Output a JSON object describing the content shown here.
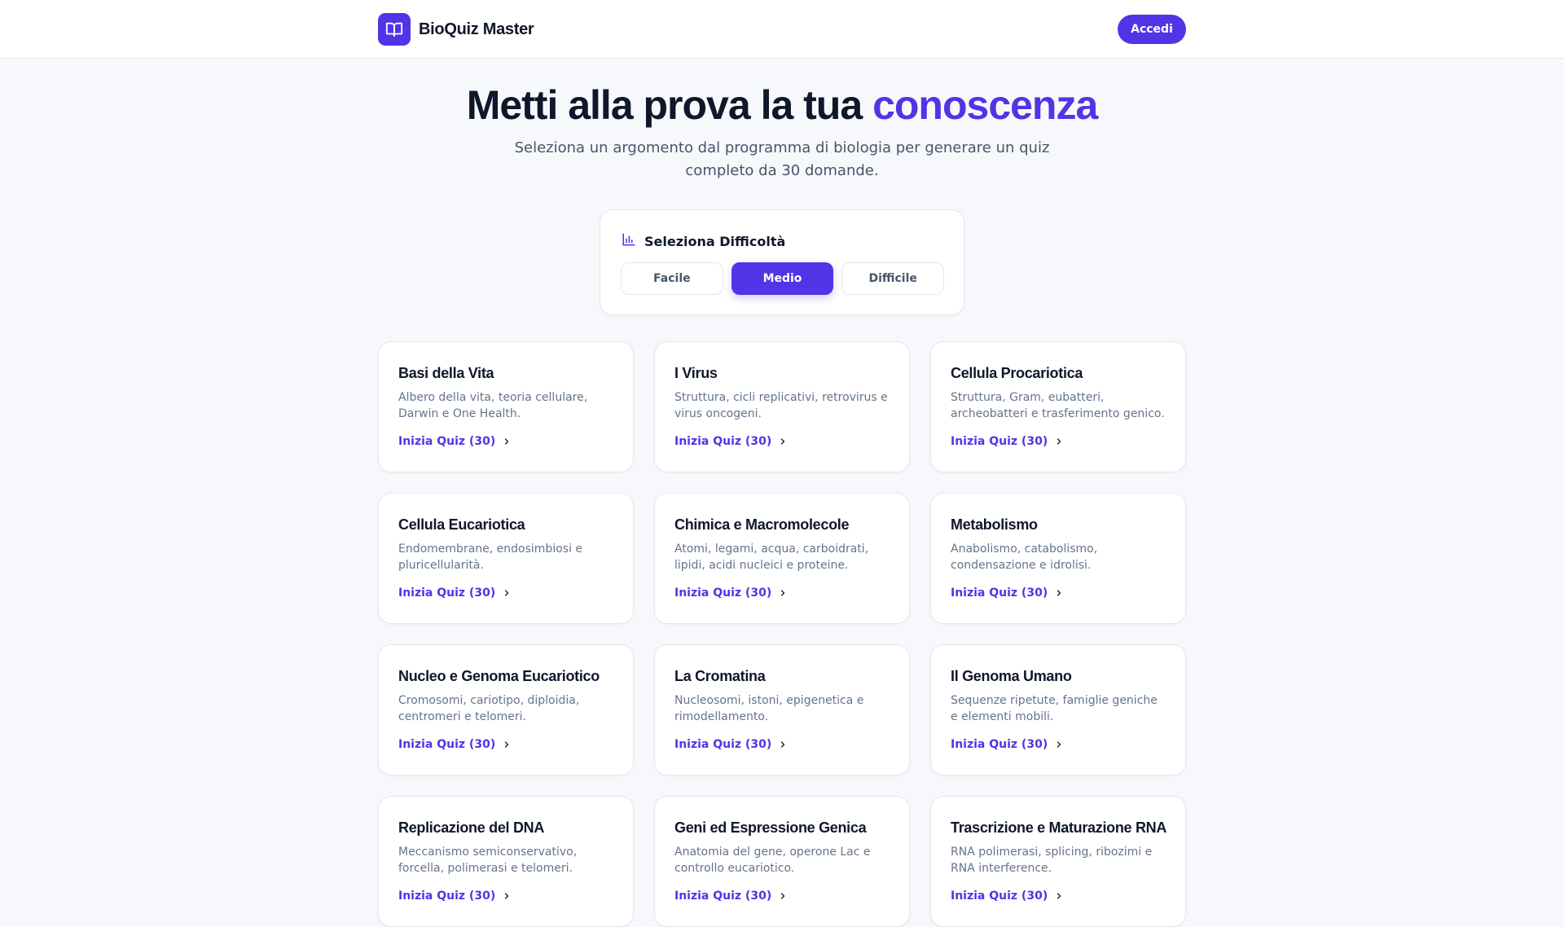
{
  "header": {
    "brand_name": "BioQuiz Master",
    "logo_icon": "book-open-icon",
    "login_label": "Accedi"
  },
  "hero": {
    "title_main": "Metti alla prova la tua",
    "title_accent": "conoscenza",
    "subtitle": "Seleziona un argomento dal programma di biologia per generare un quiz completo da 30 domande."
  },
  "difficulty": {
    "title": "Seleziona Difficoltà",
    "icon": "bar-chart-icon",
    "options": [
      "Facile",
      "Medio",
      "Difficile"
    ],
    "selected": "Medio"
  },
  "topics": [
    {
      "title": "Basi della Vita",
      "desc": "Albero della vita, teoria cellulare, Darwin e One Health.",
      "cta": "Inizia Quiz (30)"
    },
    {
      "title": "I Virus",
      "desc": "Struttura, cicli replicativi, retrovirus e virus oncogeni.",
      "cta": "Inizia Quiz (30)"
    },
    {
      "title": "Cellula Procariotica",
      "desc": "Struttura, Gram, eubatteri, archeobatteri e trasferimento genico.",
      "cta": "Inizia Quiz (30)"
    },
    {
      "title": "Cellula Eucariotica",
      "desc": "Endomembrane, endosimbiosi e pluricellularità.",
      "cta": "Inizia Quiz (30)"
    },
    {
      "title": "Chimica e Macromolecole",
      "desc": "Atomi, legami, acqua, carboidrati, lipidi, acidi nucleici e proteine.",
      "cta": "Inizia Quiz (30)"
    },
    {
      "title": "Metabolismo",
      "desc": "Anabolismo, catabolismo, condensazione e idrolisi.",
      "cta": "Inizia Quiz (30)"
    },
    {
      "title": "Nucleo e Genoma Eucariotico",
      "desc": "Cromosomi, cariotipo, diploidia, centromeri e telomeri.",
      "cta": "Inizia Quiz (30)"
    },
    {
      "title": "La Cromatina",
      "desc": "Nucleosomi, istoni, epigenetica e rimodellamento.",
      "cta": "Inizia Quiz (30)"
    },
    {
      "title": "Il Genoma Umano",
      "desc": "Sequenze ripetute, famiglie geniche e elementi mobili.",
      "cta": "Inizia Quiz (30)"
    },
    {
      "title": "Replicazione del DNA",
      "desc": "Meccanismo semiconservativo, forcella, polimerasi e telomeri.",
      "cta": "Inizia Quiz (30)"
    },
    {
      "title": "Geni ed Espressione Genica",
      "desc": "Anatomia del gene, operone Lac e controllo eucariotico.",
      "cta": "Inizia Quiz (30)"
    },
    {
      "title": "Trascrizione e Maturazione RNA",
      "desc": "RNA polimerasi, splicing, ribozimi e RNA interference.",
      "cta": "Inizia Quiz (30)"
    }
  ],
  "colors": {
    "accent": "#4f35e6",
    "background": "#f7f8fb",
    "text": "#0f172a",
    "muted": "#64748b"
  }
}
